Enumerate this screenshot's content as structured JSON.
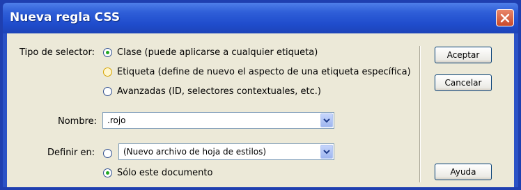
{
  "window": {
    "title": "Nueva regla CSS",
    "close_icon": "close-icon"
  },
  "selector": {
    "label": "Tipo de selector:",
    "options": [
      {
        "label": "Clase (puede aplicarse a cualquier etiqueta)",
        "selected": true
      },
      {
        "label": "Etiqueta (define de nuevo el aspecto de una etiqueta específica)",
        "selected": false
      },
      {
        "label": "Avanzadas (ID, selectores contextuales, etc.)",
        "selected": false
      }
    ]
  },
  "nombre": {
    "label": "Nombre:",
    "value": ".rojo"
  },
  "definir": {
    "label": "Definir en:",
    "file_value": "(Nuevo archivo de hoja de estilos)",
    "option_document": "Sólo este documento",
    "document_selected": true
  },
  "buttons": {
    "accept": "Aceptar",
    "cancel": "Cancelar",
    "help": "Ayuda"
  },
  "colors": {
    "titlebar": "#2b52c6",
    "dialog_bg": "#ece9d8",
    "selected_radio": "#22a822",
    "close_button": "#d65b3a"
  }
}
